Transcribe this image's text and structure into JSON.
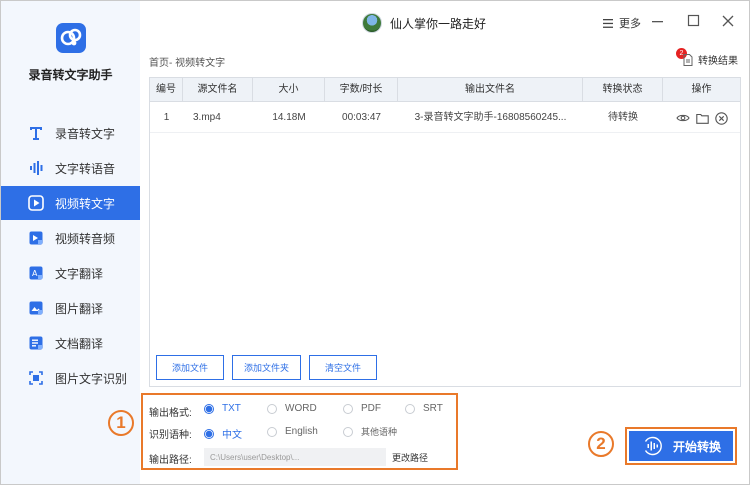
{
  "app": {
    "name": "录音转文字助手"
  },
  "titlebar": {
    "user_name": "仙人掌你一路走好",
    "more_label": "更多"
  },
  "sidebar": {
    "items": [
      {
        "label": "录音转文字",
        "icon": "text-t-icon",
        "active": false
      },
      {
        "label": "文字转语音",
        "icon": "audio-wave-icon",
        "active": false
      },
      {
        "label": "视频转文字",
        "icon": "video-play-icon",
        "active": true
      },
      {
        "label": "视频转音频",
        "icon": "video-audio-icon",
        "active": false
      },
      {
        "label": "文字翻译",
        "icon": "text-translate-icon",
        "active": false
      },
      {
        "label": "图片翻译",
        "icon": "image-translate-icon",
        "active": false
      },
      {
        "label": "文档翻译",
        "icon": "document-translate-icon",
        "active": false
      },
      {
        "label": "图片文字识别",
        "icon": "scan-ocr-icon",
        "active": false
      }
    ]
  },
  "main": {
    "breadcrumb": "首页- 视频转文字",
    "result_label": "转换结果",
    "result_badge": "2",
    "table": {
      "headers": [
        "编号",
        "源文件名",
        "大小",
        "字数/时长",
        "输出文件名",
        "转换状态",
        "操作"
      ],
      "rows": [
        {
          "num": "1",
          "source": "3.mp4",
          "size": "14.18M",
          "duration": "00:03:47",
          "output": "3-录音转文字助手-16808560245...",
          "status": "待转换"
        }
      ]
    },
    "buttons": {
      "add_file": "添加文件",
      "add_folder": "添加文件夹",
      "clear_files": "清空文件"
    }
  },
  "settings": {
    "format_label": "输出格式:",
    "format_options": [
      "TXT",
      "WORD",
      "PDF",
      "SRT"
    ],
    "format_selected": "TXT",
    "lang_label": "识别语种:",
    "lang_options": [
      "中文",
      "English",
      "其他语种"
    ],
    "lang_selected": "中文",
    "path_label": "输出路径:",
    "path_value": "C:\\Users\\user\\Desktop\\...",
    "change_path": "更改路径"
  },
  "markers": {
    "one": "1",
    "two": "2"
  },
  "start_label": "开始转换",
  "colors": {
    "accent": "#2e6fe6",
    "highlight": "#e9792a",
    "badge": "#e52222",
    "sidebar_bg": "#f3f7fd"
  }
}
